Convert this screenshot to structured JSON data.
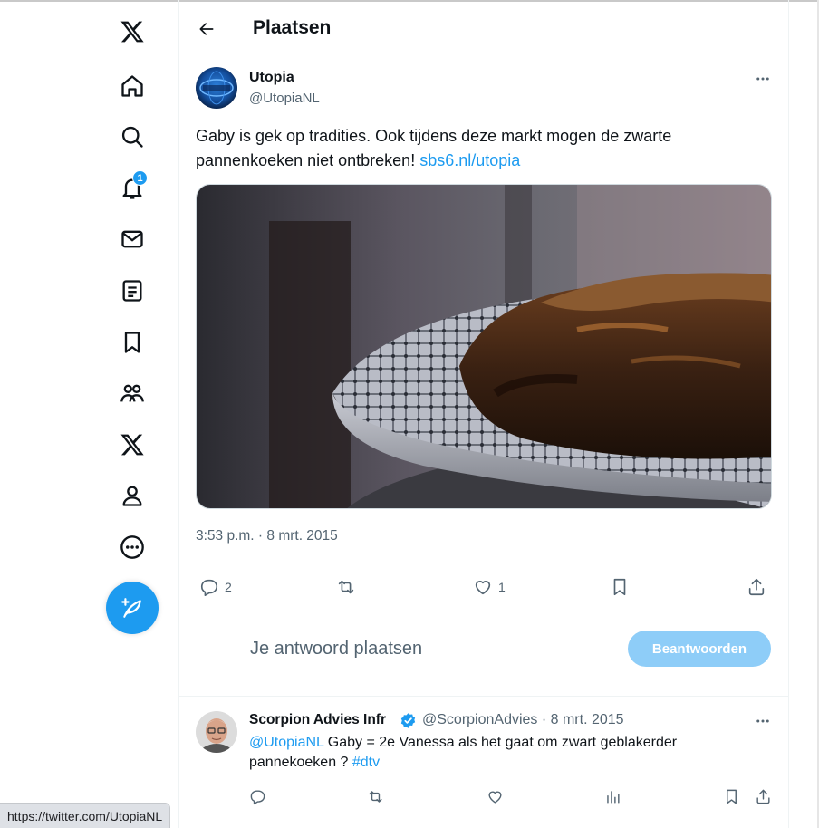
{
  "header": {
    "title": "Plaatsen"
  },
  "sidebar": {
    "notification_count": "1",
    "icons": [
      "x-logo-icon",
      "home-icon",
      "search-icon",
      "bell-icon",
      "mail-icon",
      "list-icon",
      "bookmark-icon",
      "communities-icon",
      "premium-x-icon",
      "profile-icon",
      "more-circle-icon"
    ],
    "compose_icon": "feather-plus-icon"
  },
  "tweet": {
    "author_name": "Utopia",
    "author_handle": "@UtopiaNL",
    "text": "Gaby is gek op tradities. Ook tijdens deze markt mogen de zwarte pannenkoeken niet ontbreken!",
    "link": "sbs6.nl/utopia",
    "timestamp": "3:53 p.m. · 8 mrt. 2015",
    "replies": "2",
    "likes": "1"
  },
  "reply_box": {
    "placeholder": "Je antwoord plaatsen",
    "button_label": "Beantwoorden"
  },
  "reply": {
    "author_name": "Scorpion Advies Infr",
    "meta": "@ScorpionAdvies · 8 mrt. 2015",
    "mention": "@UtopiaNL",
    "text": " Gaby = 2e Vanessa als het gaat om zwart geblakerder pannekoeken ?  ",
    "hashtag": "#dtv"
  },
  "status_bar": {
    "url": "https://twitter.com/UtopiaNL"
  },
  "colors": {
    "accent": "#1d9bf0",
    "muted_text": "#536471",
    "button_disabled": "#8ecdf8"
  }
}
